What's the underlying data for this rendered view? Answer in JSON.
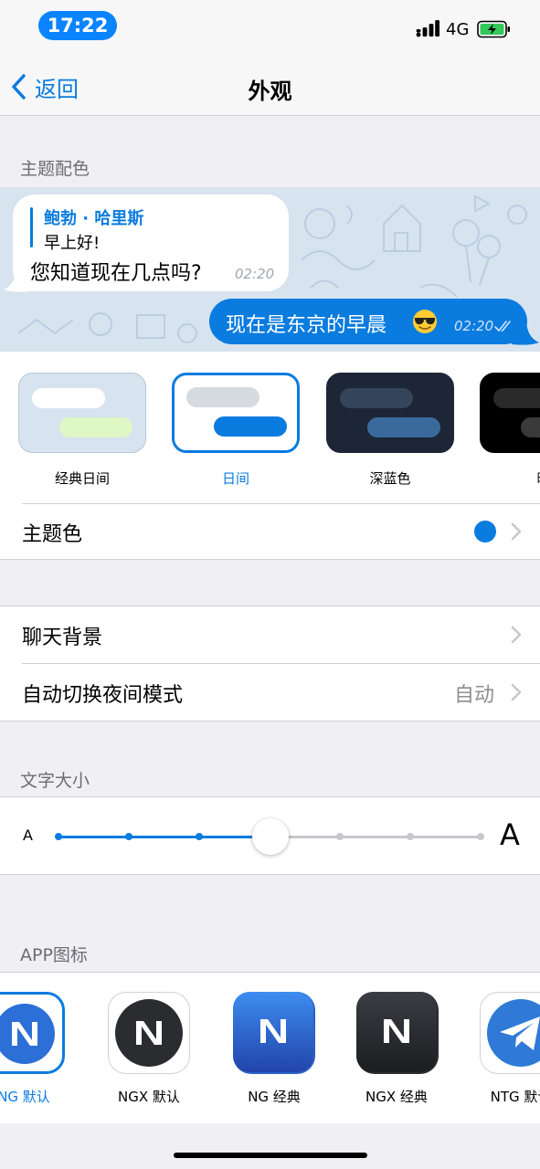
{
  "status_bar": {
    "time": "17:22",
    "network": "4G",
    "signal_icon": "signal-icon",
    "battery_icon": "battery-charging-icon"
  },
  "nav": {
    "back_label": "返回",
    "title": "外观"
  },
  "sections": {
    "theme_colors": "主题配色",
    "text_size": "文字大小",
    "app_icon": "APP图标"
  },
  "preview": {
    "incoming": {
      "reply_name": "鲍勃 · 哈里斯",
      "reply_text": "早上好!",
      "text": "您知道现在几点吗?",
      "time": "02:20"
    },
    "outgoing": {
      "text": "现在是东京的早晨",
      "emoji_icon": "sunglasses-emoji-icon",
      "time": "02:20"
    }
  },
  "themes": [
    {
      "label": "经典日间",
      "selected": false
    },
    {
      "label": "日间",
      "selected": true
    },
    {
      "label": "深蓝色",
      "selected": false
    },
    {
      "label": "暗",
      "selected": false
    }
  ],
  "rows": {
    "accent_color": {
      "label": "主题色",
      "color": "#0a7bdf"
    },
    "chat_background": {
      "label": "聊天背景"
    },
    "auto_night": {
      "label": "自动切换夜间模式",
      "value": "自动"
    }
  },
  "text_size": {
    "small_label": "A",
    "large_label": "A",
    "steps": 7,
    "selected_step": 3
  },
  "app_icons": [
    {
      "label": "NG 默认",
      "selected": true
    },
    {
      "label": "NGX 默认",
      "selected": false
    },
    {
      "label": "NG 经典",
      "selected": false
    },
    {
      "label": "NGX 经典",
      "selected": false
    },
    {
      "label": "NTG 默认",
      "selected": false
    }
  ],
  "colors": {
    "accent": "#0a7bdf",
    "background": "#efeff4",
    "chat_bg": "#d7e3ef"
  }
}
